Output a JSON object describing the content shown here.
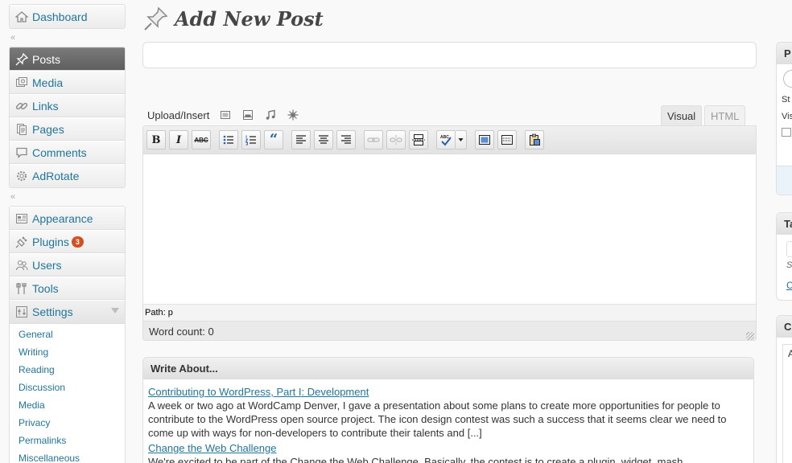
{
  "menu": {
    "dashboard": "Dashboard",
    "group1": [
      "Posts",
      "Media",
      "Links",
      "Pages",
      "Comments",
      "AdRotate"
    ],
    "group2": [
      "Appearance",
      "Plugins",
      "Users",
      "Tools",
      "Settings"
    ],
    "plugins_badge": "3",
    "settings_sub": [
      "General",
      "Writing",
      "Reading",
      "Discussion",
      "Media",
      "Privacy",
      "Permalinks",
      "Miscellaneous"
    ],
    "collapse_glyph": "«"
  },
  "page": {
    "title": "Add New Post"
  },
  "title_input": {
    "value": ""
  },
  "media": {
    "upload_label": "Upload/Insert"
  },
  "editor": {
    "tab_visual": "Visual",
    "tab_html": "HTML",
    "path": "Path: p",
    "word_count": "Word count: 0",
    "toolbar": {
      "bold": "B",
      "italic": "I",
      "strike": "ABC",
      "quote": "“"
    }
  },
  "write_about": {
    "heading": "Write About...",
    "items": [
      {
        "title": "Contributing to WordPress, Part I: Development",
        "excerpt": "A week or two ago at WordCamp Denver, I gave a presentation about some plans to create more opportunities for people to contribute to the WordPress open source project. The icon design contest was such a success that it seems clear we need to come up with ways for non-developers to contribute their talents and [...]"
      },
      {
        "title": "Change the Web Challenge",
        "excerpt": "We're excited to be part of the Change the Web Challenge. Basically, the contest is to create a plugin, widget, mash"
      }
    ]
  },
  "sidebar_fragments": {
    "publish_head": "P",
    "publish_lines": [
      "St",
      "Vis"
    ],
    "tags_head": "Ta",
    "tags_lines": [
      "S",
      "C"
    ],
    "cat_head": "C",
    "cat_line": "A"
  },
  "colors": {
    "link": "#21759b",
    "current_menu": "#6d6d6d",
    "badge": "#d54e21"
  }
}
